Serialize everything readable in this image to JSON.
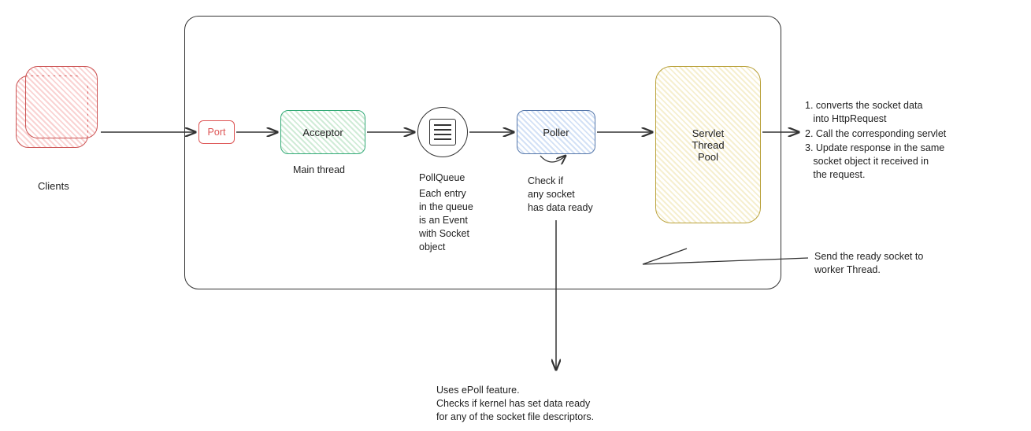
{
  "clients": {
    "label": "Clients"
  },
  "container": {},
  "port": {
    "label": "Port"
  },
  "acceptor": {
    "label": "Acceptor",
    "sublabel": "Main thread"
  },
  "pollqueue": {
    "label": "PollQueue",
    "description": "Each entry\nin the queue\nis an Event\nwith Socket\nobject"
  },
  "poller": {
    "label": "Poller",
    "sublabel": "Check if\nany socket\nhas data ready",
    "epoll_note": "Uses ePoll feature.\nChecks if kernel has set data ready\nfor any of the socket file descriptors."
  },
  "servlet_pool": {
    "label": "Servlet\nThread\nPool",
    "send_note": "Send the ready socket to\nworker Thread."
  },
  "output_steps": {
    "step1": "1. converts the socket data\n   into HttpRequest",
    "step2": "2. Call the corresponding servlet",
    "step3": "3. Update response in the same\n   socket object it received in\n   the request."
  }
}
